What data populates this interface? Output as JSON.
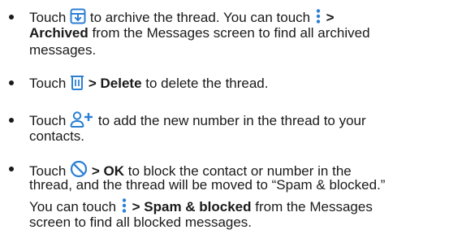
{
  "icons": {
    "archive": "archive-icon",
    "delete": "trash-icon",
    "add_contact": "add-person-icon",
    "block": "block-icon",
    "more": "more-vert-icon",
    "accent_color": "#2d7fd3"
  },
  "bullets": [
    {
      "l1_a": "Touch",
      "l1_b": "to archive the thread. You can touch",
      "l1_c": ">",
      "l2_a": "Archived",
      "l2_b": "from the Messages screen to find all archived",
      "l3_a": "messages."
    },
    {
      "l1_a": "Touch",
      "l1_b": "> Delete",
      "l1_c": "to delete the thread."
    },
    {
      "l1_a": "Touch",
      "l1_b": "to add the new number in the thread to your",
      "l2_a": "contacts."
    },
    {
      "l1_a": "Touch",
      "l1_b": "> OK",
      "l1_c": "to block the contact or number in the",
      "l2_a": "thread, and the thread will be moved to “Spam & blocked.”",
      "l3_a": "You can touch",
      "l3_b": "> Spam & blocked",
      "l3_c": "from the Messages",
      "l4_a": "screen to find all blocked messages."
    }
  ]
}
